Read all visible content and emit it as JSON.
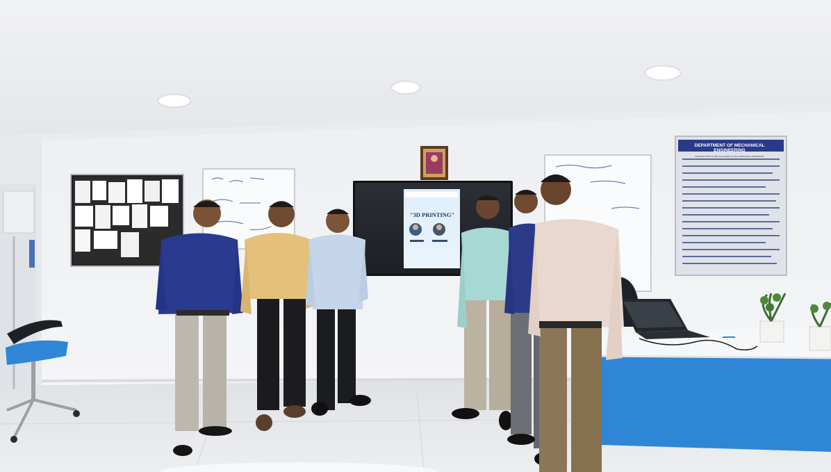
{
  "scene": {
    "notice_board": {
      "title": "DEPARTMENT OF MECHANICAL ENGINEERING",
      "subtitle": "INSTRUCTIONS TO BE FOLLOWED IN THE COMPUTER LABORATORY"
    },
    "display_slide": {
      "heading": "\"3D PRINTING\""
    },
    "colors": {
      "wall": "#eef0f3",
      "ceiling": "#f4f5f7",
      "floor": "#e8e9ec",
      "desk_blue": "#2f86d6",
      "notice_header": "#2a3a8a"
    }
  }
}
